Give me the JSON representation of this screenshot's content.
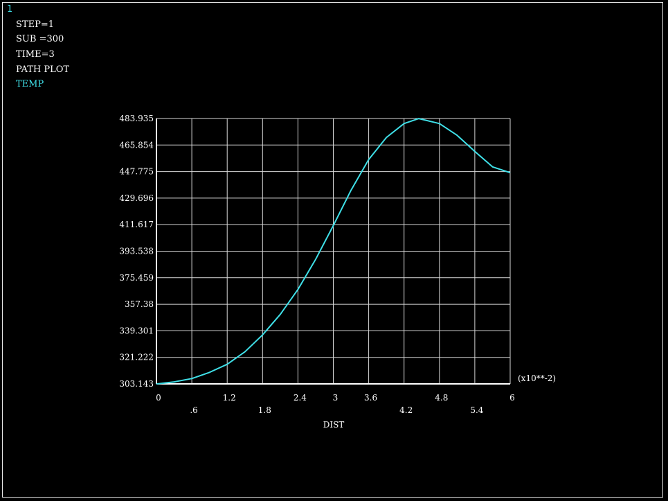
{
  "window_number": "1",
  "header": {
    "step": "STEP=1",
    "sub": "SUB =300",
    "time": "TIME=3",
    "plot_type": "PATH PLOT",
    "variable": "TEMP"
  },
  "colors": {
    "background": "#000000",
    "grid": "#d9d9d9",
    "axis": "#ffffff",
    "curve": "#3fe0e8",
    "text": "#ffffff",
    "accent_text": "#3fe0e8"
  },
  "chart_data": {
    "type": "line",
    "title": "",
    "xlabel": "DIST",
    "x_multiplier_label": "(x10**-2)",
    "ylabel": "",
    "xlim": [
      0,
      6
    ],
    "ylim": [
      303.143,
      483.935
    ],
    "grid": true,
    "x_ticks_top": [
      "0",
      "1.2",
      "2.4",
      "3",
      "3.6",
      "4.8",
      "6"
    ],
    "x_ticks_top_values": [
      0,
      1.2,
      2.4,
      3.0,
      3.6,
      4.8,
      6.0
    ],
    "x_ticks_bottom": [
      ".6",
      "1.8",
      "4.2",
      "5.4"
    ],
    "x_ticks_bottom_values": [
      0.6,
      1.8,
      4.2,
      5.4
    ],
    "x_grid_values": [
      0,
      0.6,
      1.2,
      1.8,
      2.4,
      3.0,
      3.6,
      4.2,
      4.8,
      5.4,
      6.0
    ],
    "y_ticks": [
      "303.143",
      "321.222",
      "339.301",
      "357.38",
      "375.459",
      "393.538",
      "411.617",
      "429.696",
      "447.775",
      "465.854",
      "483.935"
    ],
    "y_tick_values": [
      303.143,
      321.222,
      339.301,
      357.38,
      375.459,
      393.538,
      411.617,
      429.696,
      447.775,
      465.854,
      483.935
    ],
    "series": [
      {
        "x": [
          0,
          0.3,
          0.6,
          0.9,
          1.2,
          1.5,
          1.8,
          2.1,
          2.4,
          2.7,
          3.0,
          3.3,
          3.6,
          3.9,
          4.2,
          4.45,
          4.8,
          5.1,
          5.4,
          5.7,
          6.0
        ],
        "y": [
          303.1,
          304.5,
          306.8,
          311.0,
          316.5,
          325.0,
          336.5,
          350.5,
          367.5,
          388.0,
          411.0,
          435.0,
          456.0,
          471.0,
          480.5,
          483.9,
          480.5,
          472.5,
          461.5,
          451.0,
          447.0
        ]
      }
    ]
  }
}
